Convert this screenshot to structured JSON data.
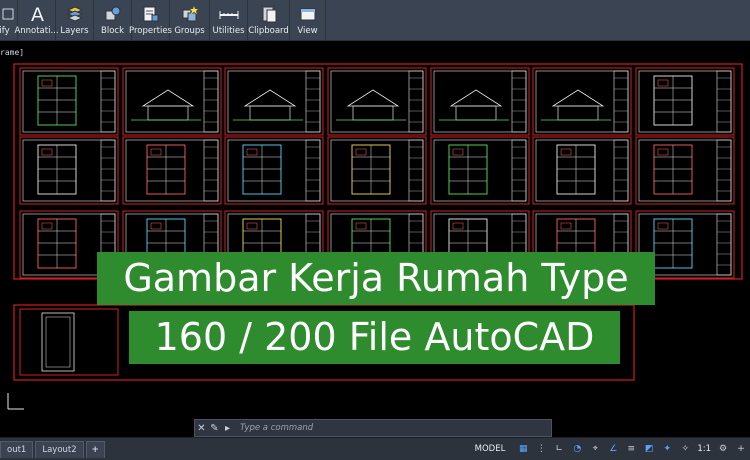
{
  "ribbon": {
    "groups": [
      {
        "label": "ify",
        "icon": "modify-icon"
      },
      {
        "label": "Annotati...",
        "icon": "annotation-icon"
      },
      {
        "label": "Layers",
        "icon": "layers-icon"
      },
      {
        "label": "Block",
        "icon": "block-icon"
      },
      {
        "label": "Properties",
        "icon": "properties-icon"
      },
      {
        "label": "Groups",
        "icon": "groups-icon"
      },
      {
        "label": "Utilities",
        "icon": "utilities-icon"
      },
      {
        "label": "Clipboard",
        "icon": "clipboard-icon"
      },
      {
        "label": "View",
        "icon": "view-icon"
      }
    ]
  },
  "viewport": {
    "label": "rame]"
  },
  "overlay": {
    "line1": "Gambar Kerja Rumah Type",
    "line2": "160 / 200 File AutoCAD",
    "bg_color": "#2e8b2e"
  },
  "command_line": {
    "placeholder": "Type a command"
  },
  "status_bar": {
    "tabs": [
      "out1",
      "Layout2",
      "+"
    ],
    "model_label": "MODEL",
    "scale_label": "1:1"
  },
  "colors": {
    "frame": "#d21f1f",
    "ribbon": "#3b4453",
    "canvas": "#000000"
  }
}
